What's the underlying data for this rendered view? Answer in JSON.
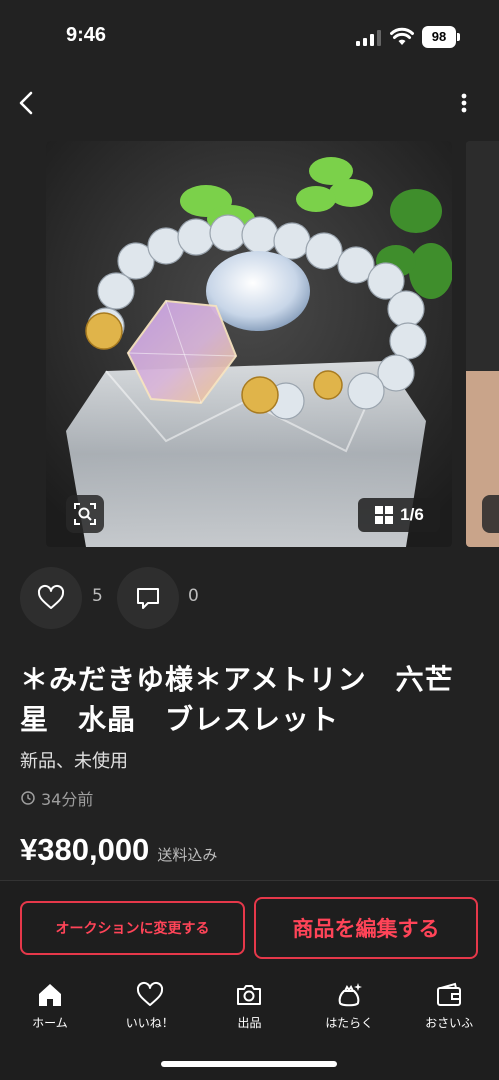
{
  "status": {
    "time": "9:46",
    "battery": "98"
  },
  "product": {
    "image_counter": "1/6",
    "likes": "5",
    "comments": "0",
    "title": "＊みだきゆ様＊アメトリン　六芒星　水晶　ブレスレット",
    "condition": "新品、未使用",
    "posted": "34分前",
    "price": "¥380,000",
    "price_note": "送料込み"
  },
  "actions": {
    "auction_label": "オークションに変更する",
    "edit_label": "商品を編集する"
  },
  "tabs": [
    {
      "label": "ホーム",
      "icon": "home-icon"
    },
    {
      "label": "いいね！",
      "icon": "heart-icon"
    },
    {
      "label": "出品",
      "icon": "camera-icon"
    },
    {
      "label": "はたらく",
      "icon": "sprout-bag-icon"
    },
    {
      "label": "おさいふ",
      "icon": "wallet-icon"
    }
  ],
  "colors": {
    "background": "#222222",
    "accent": "#e6384a"
  }
}
